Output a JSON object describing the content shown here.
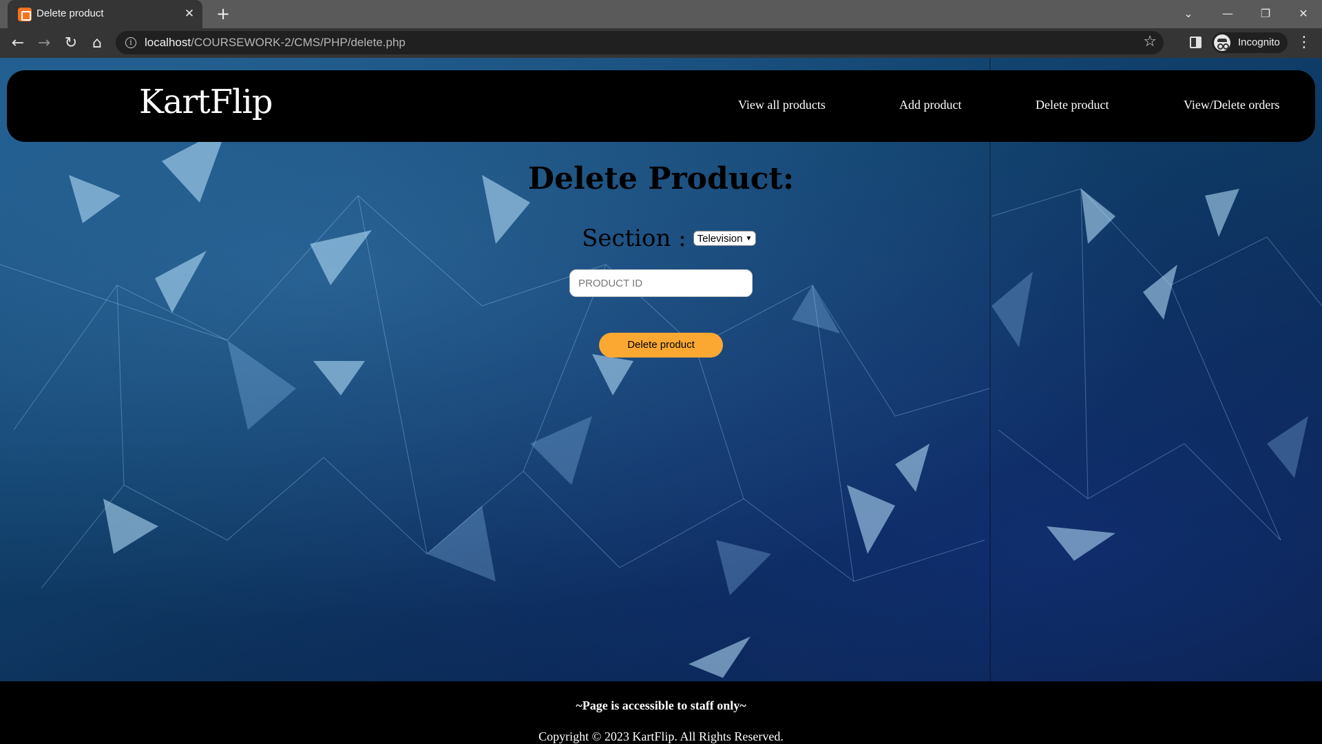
{
  "browser": {
    "tab_title": "Delete product",
    "tab_close": "✕",
    "new_tab": "+",
    "url_host": "localhost",
    "url_path": "/COURSEWORK-2/CMS/PHP/delete.php",
    "profile_label": "Incognito",
    "icons": [
      "back-icon",
      "forward-icon",
      "reload-icon",
      "home-icon",
      "info-icon",
      "star-icon",
      "side-panel-icon",
      "incognito-icon",
      "menu-icon"
    ]
  },
  "site": {
    "brand": "KartFlip",
    "nav": [
      {
        "label": "View all products"
      },
      {
        "label": "Add product"
      },
      {
        "label": "Delete product"
      },
      {
        "label": "View/Delete orders"
      }
    ]
  },
  "form": {
    "heading": "Delete Product:",
    "section_label": "Section :",
    "section_selected": "Television",
    "product_id_placeholder": "PRODUCT ID",
    "product_id_value": "",
    "submit_label": "Delete product",
    "submit_color": "#fba832"
  },
  "footer": {
    "note": "~Page is accessible to staff only~",
    "copyright": "Copyright © 2023 KartFlip. All Rights Reserved."
  }
}
